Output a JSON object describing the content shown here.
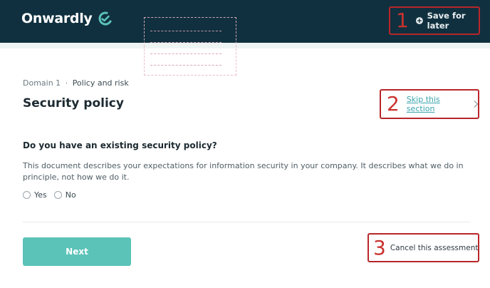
{
  "header": {
    "brand_name": "Onwardly",
    "save": {
      "callout_number": "1",
      "icon": "plus-circle-icon",
      "label": "Save for later"
    }
  },
  "breadcrumb": {
    "domain": "Domain 1",
    "separator": "·",
    "section": "Policy and risk"
  },
  "page": {
    "title": "Security policy",
    "skip": {
      "callout_number": "2",
      "label": "Skip this section",
      "icon": "chevron-right-icon"
    }
  },
  "question": {
    "text": "Do you have an existing security policy?",
    "description": "This document describes your expectations for information security in your company. It describes what we do in principle, not how we do it.",
    "options": [
      "Yes",
      "No"
    ]
  },
  "footer": {
    "next_label": "Next",
    "cancel": {
      "callout_number": "3",
      "label": "Cancel this assessment"
    }
  },
  "colors": {
    "header_bg": "#10303f",
    "accent_teal": "#5bc3b8",
    "link_teal": "#3ba5b0",
    "callout_red": "#c8322e"
  }
}
